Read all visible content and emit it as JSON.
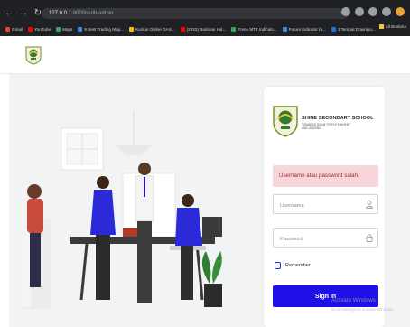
{
  "browser": {
    "url_host": "127.0.0.1",
    "url_path": ":8000/auth/admin",
    "bookmarks": [
      {
        "label": "Gmail",
        "color": "#ea4335"
      },
      {
        "label": "YouTube",
        "color": "#ff0000"
      },
      {
        "label": "Maps",
        "color": "#34a853"
      },
      {
        "label": "9 Best Trading Map...",
        "color": "#4285f4"
      },
      {
        "label": "Kursus Online GAS...",
        "color": "#fbbc05"
      },
      {
        "label": "(2932) Bantuan Hid...",
        "color": "#ff0000"
      },
      {
        "label": "Forex MT4 Indicato...",
        "color": "#34a853"
      },
      {
        "label": "Future Indicator fo...",
        "color": "#4285f4"
      },
      {
        "label": "1 Tempat Downloa...",
        "color": "#1a73e8"
      }
    ],
    "all_bookmarks": "All Bookma"
  },
  "school": {
    "name": "SHINE SECONDARY SCHOOL",
    "subtitle1": "TOWARDS SHINE TRIPLE EMINENT",
    "subtitle2": "AND LEADING"
  },
  "login": {
    "error": "Username atau password salah.",
    "username_placeholder": "Username",
    "password_placeholder": "Password",
    "remember_label": "Remember",
    "signin_label": "Sign In"
  },
  "watermark": {
    "line1": "Activate Windows",
    "line2": "Go to Settings to activate Windows."
  },
  "colors": {
    "accent": "#1f10e8",
    "alert_bg": "#f6d6da",
    "alert_text": "#9b2a35"
  }
}
